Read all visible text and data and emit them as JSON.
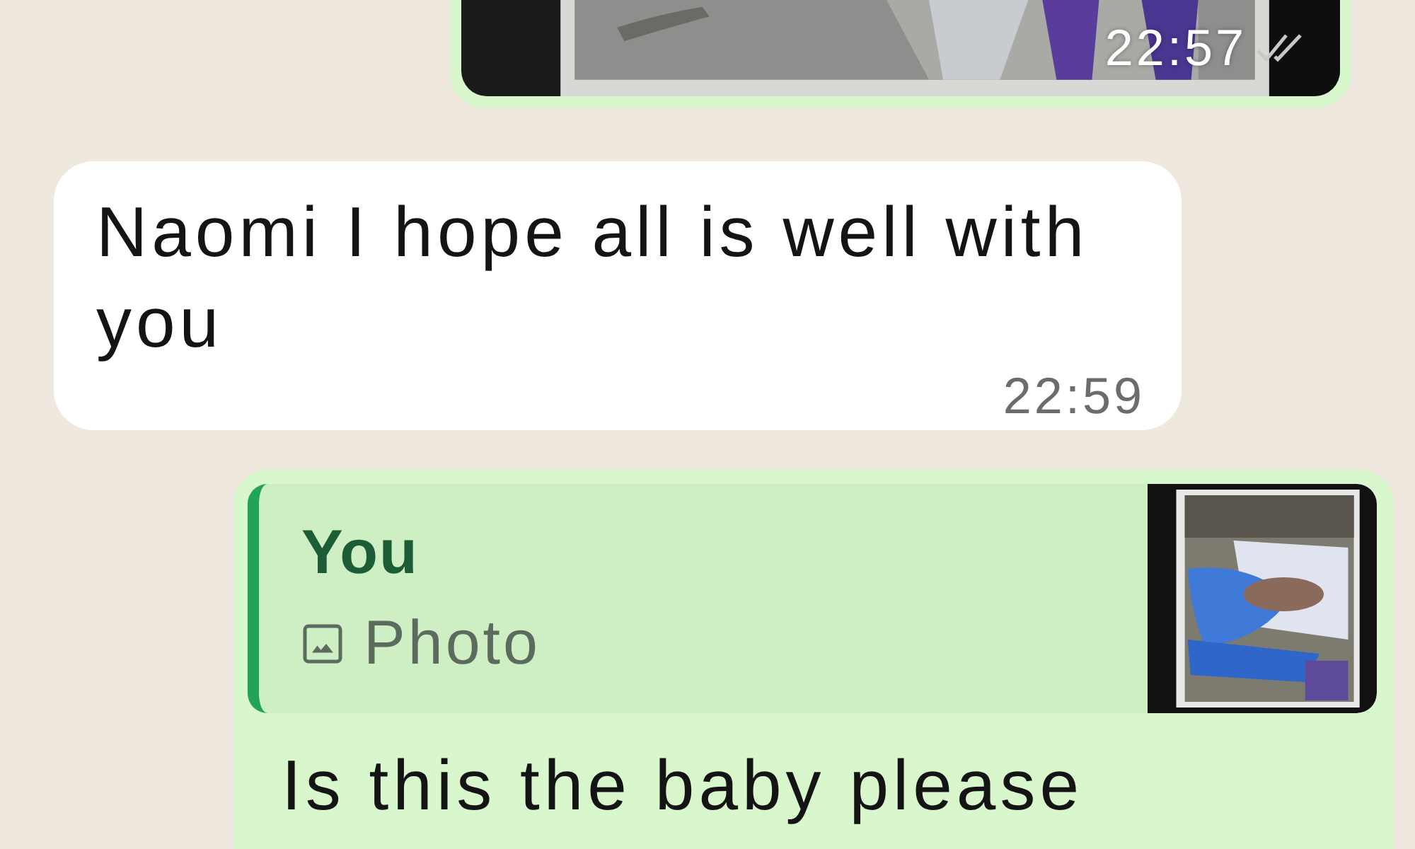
{
  "messages": [
    {
      "outgoing": true,
      "time": "22:57",
      "read": false
    },
    {
      "kind": "text",
      "outgoing": false,
      "text": "Naomi I hope all is well with you",
      "time": "22:59"
    },
    {
      "kind": "reply",
      "outgoing": true,
      "quote": {
        "author": "You",
        "label": "Photo"
      },
      "text": "Is this the baby please"
    }
  ]
}
